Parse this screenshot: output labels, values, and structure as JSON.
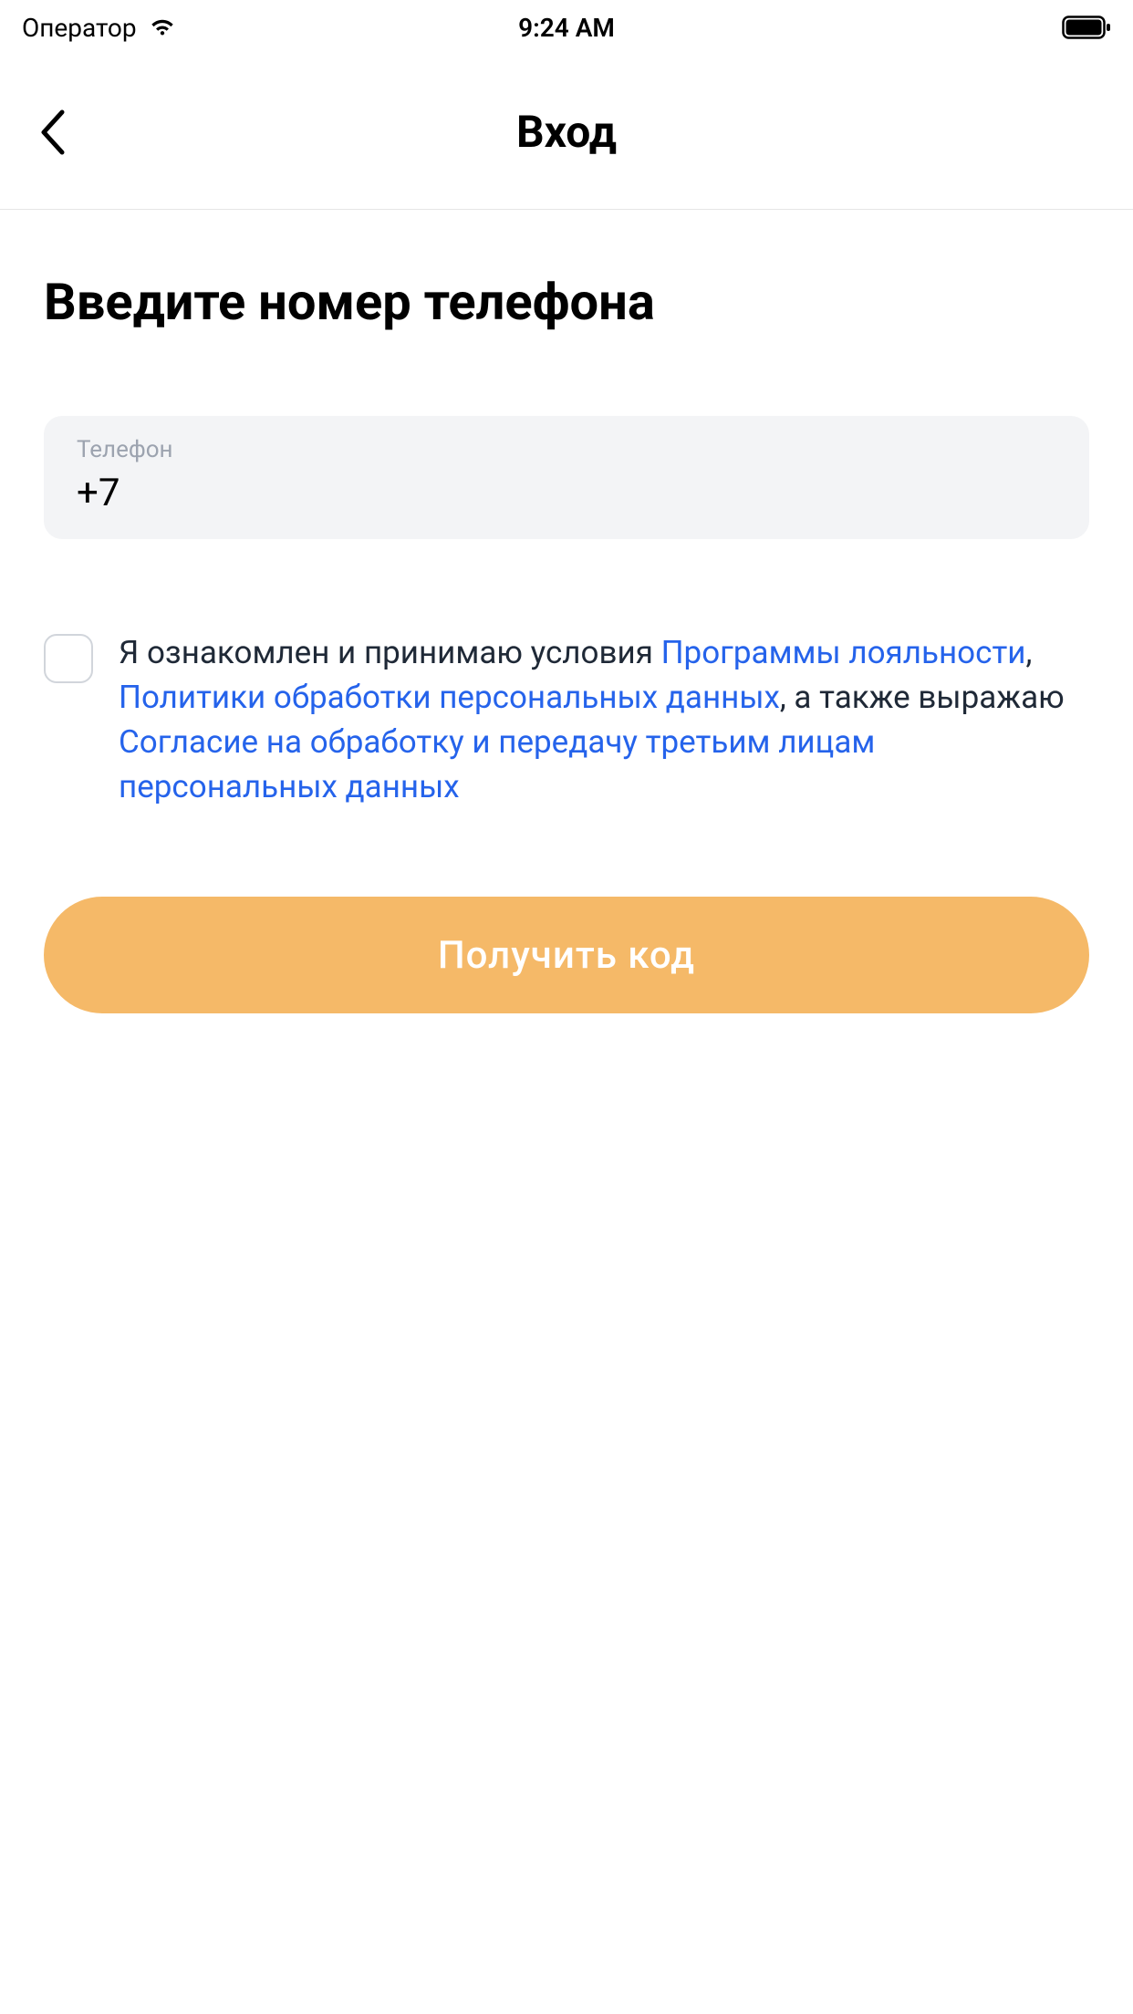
{
  "status_bar": {
    "carrier": "Оператор",
    "time": "9:24 AM"
  },
  "nav": {
    "title": "Вход"
  },
  "main": {
    "heading": "Введите номер телефона",
    "phone_label": "Телефон",
    "phone_value": "+7",
    "consent": {
      "prefix": "Я ознакомлен и принимаю условия ",
      "link1": "Программы лояльности",
      "sep1": ", ",
      "link2": "Политики обработки персональных данных",
      "sep2": ", а также выражаю ",
      "link3": "Согласие на обработку и передачу третьим лицам персональных данных"
    },
    "submit_label": "Получить код"
  }
}
